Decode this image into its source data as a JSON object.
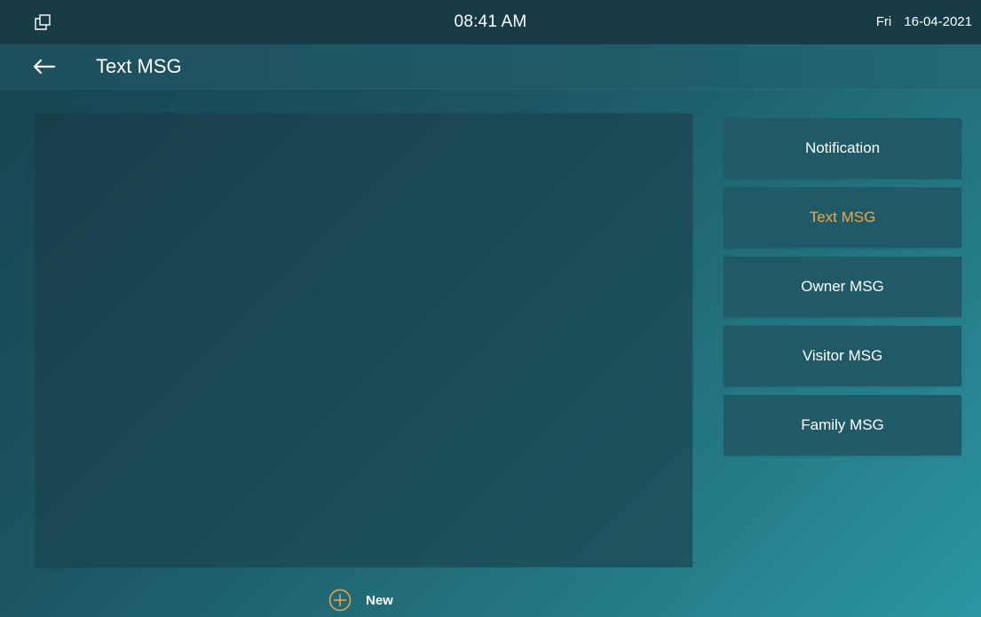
{
  "status_bar": {
    "window_icon": "window-restore-icon",
    "time": "08:41 AM",
    "day": "Fri",
    "date": "16-04-2021"
  },
  "title_bar": {
    "back_icon": "arrow-left-icon",
    "title": "Text MSG"
  },
  "categories": [
    {
      "label": "Notification",
      "active": false
    },
    {
      "label": "Text MSG",
      "active": true
    },
    {
      "label": "Owner MSG",
      "active": false
    },
    {
      "label": "Visitor MSG",
      "active": false
    },
    {
      "label": "Family MSG",
      "active": false
    }
  ],
  "new_button": {
    "label": "New",
    "icon": "plus-circle-icon"
  },
  "colors": {
    "accent": "#f0a64b",
    "status_bar": "#173c47",
    "menu_item": "#1f5a66"
  }
}
